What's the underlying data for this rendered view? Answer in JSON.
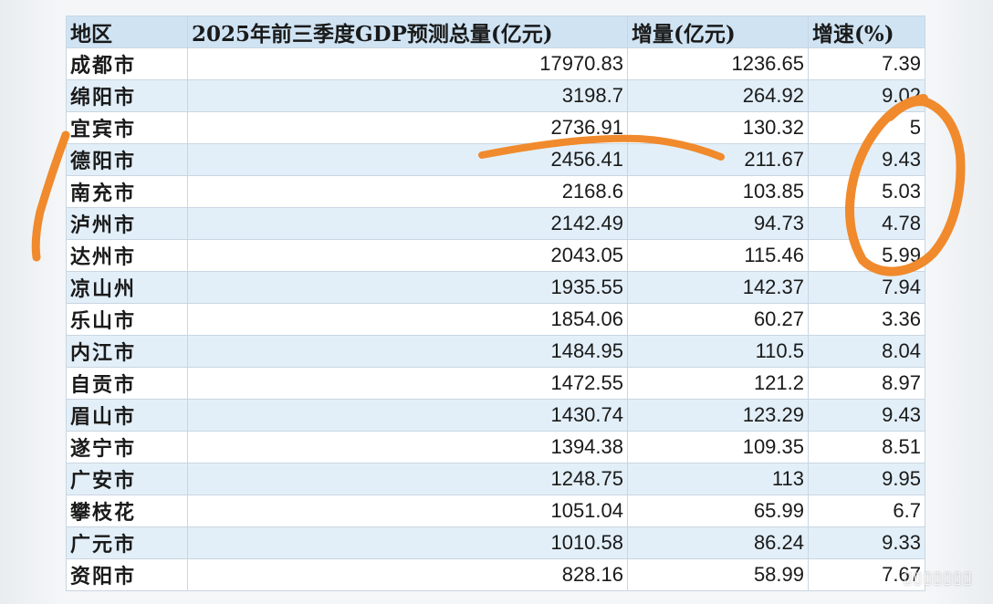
{
  "table": {
    "headers": [
      "地区",
      "2025年前三季度GDP预测总量(亿元)",
      "增量(亿元)",
      "增速(%)"
    ],
    "rows": [
      [
        "成都市",
        "17970.83",
        "1236.65",
        "7.39"
      ],
      [
        "绵阳市",
        "3198.7",
        "264.92",
        "9.02"
      ],
      [
        "宜宾市",
        "2736.91",
        "130.32",
        "5"
      ],
      [
        "德阳市",
        "2456.41",
        "211.67",
        "9.43"
      ],
      [
        "南充市",
        "2168.6",
        "103.85",
        "5.03"
      ],
      [
        "泸州市",
        "2142.49",
        "94.73",
        "4.78"
      ],
      [
        "达州市",
        "2043.05",
        "115.46",
        "5.99"
      ],
      [
        "凉山州",
        "1935.55",
        "142.37",
        "7.94"
      ],
      [
        "乐山市",
        "1854.06",
        "60.27",
        "3.36"
      ],
      [
        "内江市",
        "1484.95",
        "110.5",
        "8.04"
      ],
      [
        "自贡市",
        "1472.55",
        "121.2",
        "8.97"
      ],
      [
        "眉山市",
        "1430.74",
        "123.29",
        "9.43"
      ],
      [
        "遂宁市",
        "1394.38",
        "109.35",
        "8.51"
      ],
      [
        "广安市",
        "1248.75",
        "113",
        "9.95"
      ],
      [
        "攀枝花",
        "1051.04",
        "65.99",
        "6.7"
      ],
      [
        "广元市",
        "1010.58",
        "86.24",
        "9.33"
      ],
      [
        "资阳市",
        "828.16",
        "58.99",
        "7.67"
      ]
    ]
  },
  "annotations": {
    "stroke_color": "#f08a2c",
    "marks": [
      "left-bracket-stroke",
      "underline-stroke",
      "circle-stroke"
    ]
  }
}
